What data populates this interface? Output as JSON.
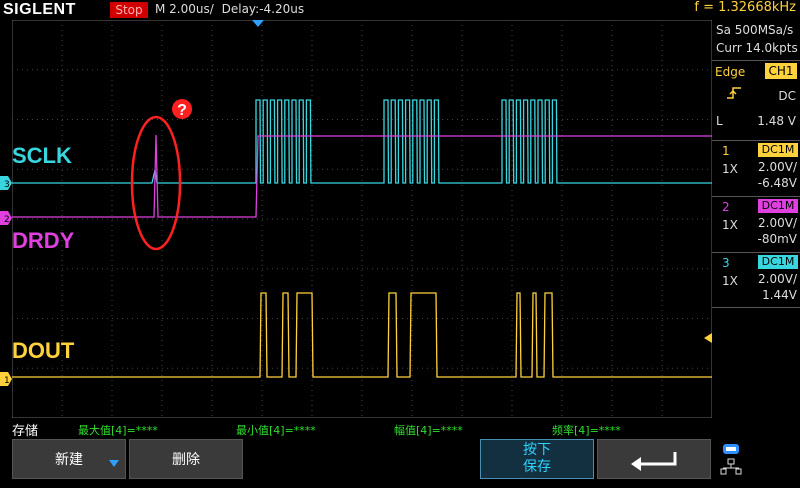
{
  "brand": "SIGLENT",
  "run_state": "Stop",
  "timebase": "M 2.00us/",
  "delay": "Delay:-4.20us",
  "frequency": "f = 1.32668kHz",
  "acquisition": {
    "sample_rate": "Sa 500MSa/s",
    "memory": "Curr 14.0kpts"
  },
  "trigger": {
    "type": "Edge",
    "source": "CH1",
    "coupling": "DC",
    "level_label": "L",
    "level": "1.48 V"
  },
  "channels": [
    {
      "num": "1",
      "coupling": "DC1M",
      "probe": "1X",
      "vdiv": "2.00V/",
      "offset": "-6.48V",
      "color": "#ffd23c"
    },
    {
      "num": "2",
      "coupling": "DC1M",
      "probe": "1X",
      "vdiv": "2.00V/",
      "offset": "-80mV",
      "color": "#e040e0"
    },
    {
      "num": "3",
      "coupling": "DC1M",
      "probe": "1X",
      "vdiv": "2.00V/",
      "offset": "1.44V",
      "color": "#38d7e0"
    }
  ],
  "trace_labels": {
    "sclk": "SCLK",
    "drdy": "DRDY",
    "dout": "DOUT",
    "question": "?"
  },
  "status_bar": {
    "mode": "存储",
    "max": "最大值[4]=****",
    "min": "最小值[4]=****",
    "amplitude": "幅值[4]=****",
    "frequency": "频率[4]=****"
  },
  "menu": {
    "new_label": "新建",
    "delete_label": "删除",
    "press_label": "按下",
    "save_label": "保存"
  }
}
